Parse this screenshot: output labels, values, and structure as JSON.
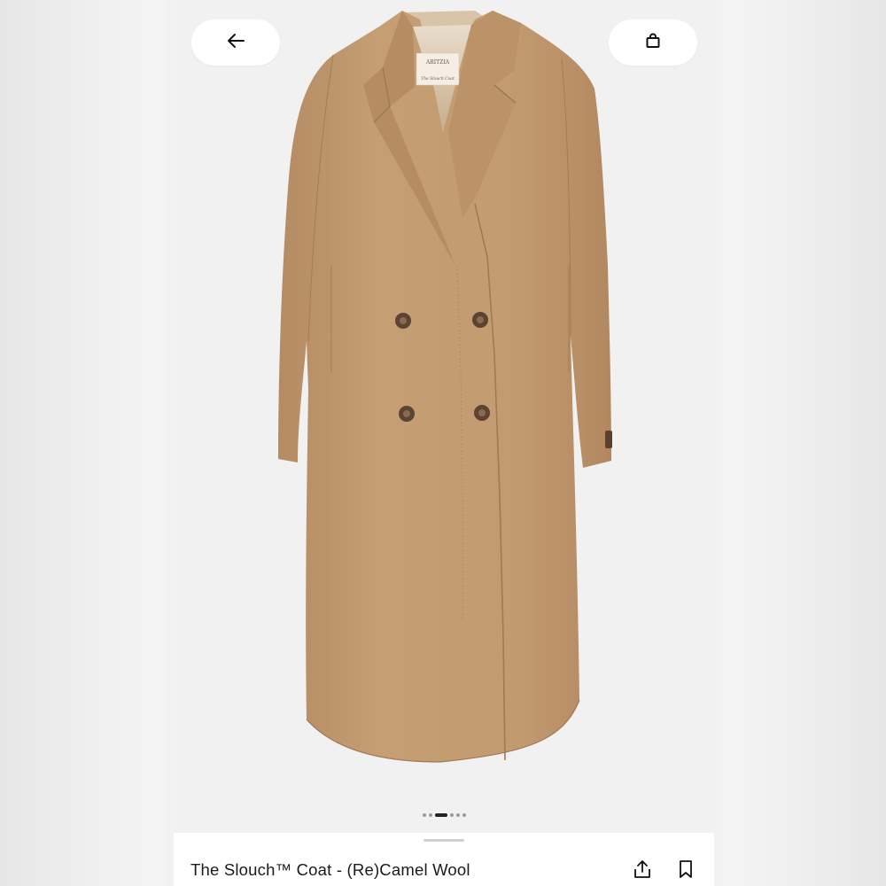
{
  "product": {
    "title": "The Slouch™ Coat - (Re)Camel Wool",
    "label_brand": "ARITZIA",
    "label_name": "The Slouch Coat"
  },
  "gallery": {
    "count": 6,
    "active_index": 2
  },
  "icons": {
    "back": "arrow-left-icon",
    "bag": "shopping-bag-icon",
    "share": "share-icon",
    "save": "bookmark-icon"
  },
  "colors": {
    "coat": "#c29a70",
    "background": "#f1f1f1",
    "button": "#ffffff"
  }
}
